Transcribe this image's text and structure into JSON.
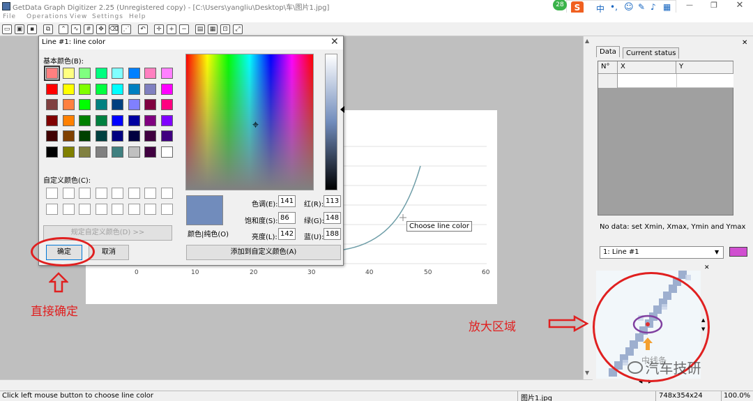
{
  "app": {
    "title": "GetData Graph Digitizer 2.25 (Unregistered copy) - [C:\\Users\\yangliu\\Desktop\\车\\图片1.jpg]"
  },
  "menu": [
    "File",
    "Operations",
    "View",
    "Settings",
    "Help"
  ],
  "graph": {
    "x_ticks": [
      "0",
      "10",
      "20",
      "30",
      "40",
      "50",
      "60"
    ],
    "tooltip": "Choose line color"
  },
  "dialog": {
    "title": "Line #1: line color",
    "basic_colors_label": "基本颜色(B):",
    "custom_colors_label": "自定义颜色(C):",
    "define_custom_button": "规定自定义颜色(D) >>",
    "ok_button": "确定",
    "cancel_button": "取消",
    "color_solid_label": "颜色|纯色(O)",
    "add_custom_button": "添加到自定义颜色(A)",
    "hue_label": "色调(E):",
    "hue_value": "141",
    "sat_label": "饱和度(S):",
    "sat_value": "86",
    "lum_label": "亮度(L):",
    "lum_value": "142",
    "red_label": "红(R):",
    "red_value": "113",
    "green_label": "绿(G):",
    "green_value": "148",
    "blue_label": "蓝(U):",
    "blue_value": "188",
    "selected_color": "#718cbc",
    "basic_colors": [
      "#ff8080",
      "#ffff80",
      "#80ff80",
      "#00ff80",
      "#80ffff",
      "#0080ff",
      "#ff80c0",
      "#ff80ff",
      "#ff0000",
      "#ffff00",
      "#80ff00",
      "#00ff40",
      "#00ffff",
      "#0080c0",
      "#8080c0",
      "#ff00ff",
      "#804040",
      "#ff8040",
      "#00ff00",
      "#008080",
      "#004080",
      "#8080ff",
      "#800040",
      "#ff0080",
      "#800000",
      "#ff8000",
      "#008000",
      "#008040",
      "#0000ff",
      "#0000a0",
      "#800080",
      "#8000ff",
      "#400000",
      "#804000",
      "#004000",
      "#004040",
      "#000080",
      "#000040",
      "#400040",
      "#400080",
      "#000000",
      "#808000",
      "#808040",
      "#808080",
      "#408080",
      "#c0c0c0",
      "#400040",
      "#ffffff"
    ]
  },
  "right_panel": {
    "tab_data": "Data",
    "tab_status": "Current status",
    "col_n": "N°",
    "col_x": "X",
    "col_y": "Y",
    "no_data": "No data: set Xmin, Xmax, Ymin and Ymax",
    "line_select": "1: Line #1",
    "line_color": "#d04fd0"
  },
  "status": {
    "hint": "Click left mouse button to choose line color",
    "file": "图片1.jpg",
    "dims": "748x354x24",
    "zoom": "100.0%"
  },
  "annotations": {
    "confirm_text": "直接确定",
    "zoom_text": "放大区域",
    "watermark": "汽车技研",
    "watermark_small": "中线条"
  },
  "ime": {
    "badge": "28",
    "lang": "中"
  }
}
